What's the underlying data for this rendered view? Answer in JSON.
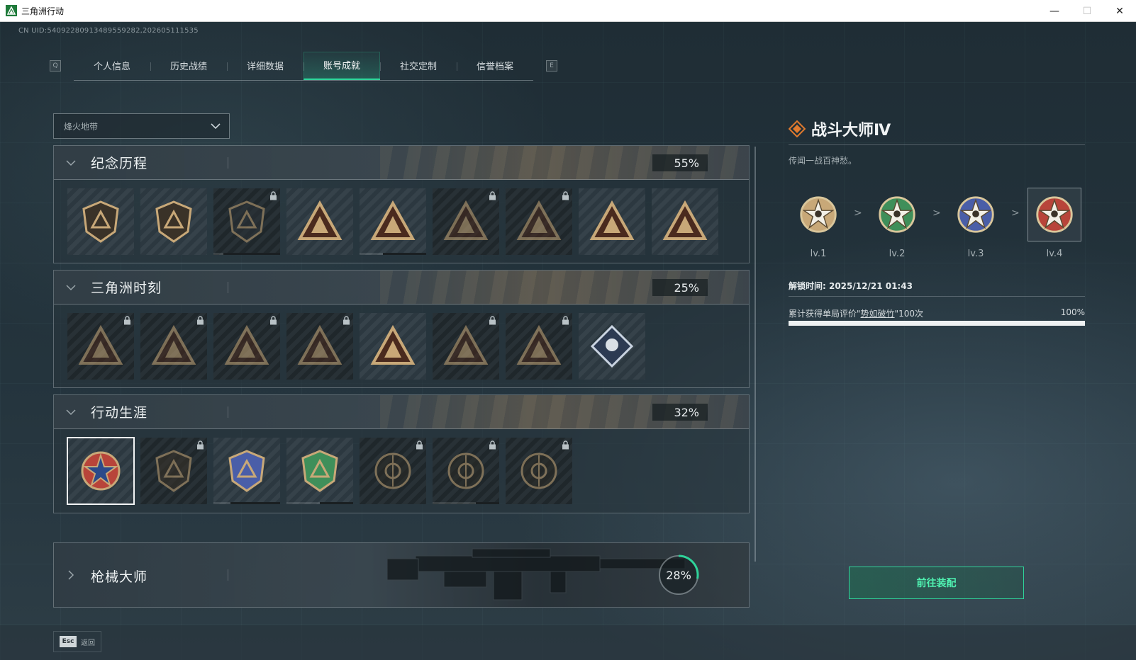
{
  "window": {
    "title": "三角洲行动",
    "minimize": "—",
    "maximize": "☐",
    "close": "✕"
  },
  "uid": "CN UID:540922809134895592​82,202605111535",
  "tabs": {
    "left_key": "Q",
    "right_key": "E",
    "items": [
      {
        "label": "个人信息"
      },
      {
        "label": "历史战绩"
      },
      {
        "label": "详细数据"
      },
      {
        "label": "账号成就",
        "active": true
      },
      {
        "label": "社交定制"
      },
      {
        "label": "信誉档案"
      }
    ]
  },
  "mode_dropdown": {
    "value": "烽火地带"
  },
  "sections": [
    {
      "title": "纪念历程",
      "percent": "55%",
      "badges": [
        {
          "icon": "delta-shield-emblem",
          "locked": false
        },
        {
          "icon": "helicopter-emblem",
          "locked": false
        },
        {
          "icon": "dark-shield-emblem",
          "locked": true,
          "progress": 0.85
        },
        {
          "icon": "doc-triangle-emblem",
          "locked": false
        },
        {
          "icon": "crest-55-emblem",
          "locked": false,
          "progress": 0.65
        },
        {
          "icon": "hooded-figure-emblem",
          "locked": true
        },
        {
          "icon": "skull-guns-emblem",
          "locked": true
        },
        {
          "icon": "hand-triangle-emblem",
          "locked": false
        },
        {
          "icon": "number-one-emblem",
          "locked": false
        }
      ]
    },
    {
      "title": "三角洲时刻",
      "percent": "25%",
      "badges": [
        {
          "icon": "box-triangle-emblem",
          "locked": true
        },
        {
          "icon": "robot-triangle-emblem",
          "locked": true
        },
        {
          "icon": "soldier-triangle-emblem",
          "locked": true
        },
        {
          "icon": "wreath-triangle-emblem",
          "locked": true
        },
        {
          "icon": "squad-triangle-emblem",
          "locked": false
        },
        {
          "icon": "tiger-triangle-emblem",
          "locked": true
        },
        {
          "icon": "fish-triangle-emblem",
          "locked": true
        },
        {
          "icon": "rose-diamond-emblem",
          "locked": false
        }
      ]
    },
    {
      "title": "行动生涯",
      "percent": "32%",
      "badges": [
        {
          "icon": "combat-master-star-emblem",
          "locked": false,
          "selected": true
        },
        {
          "icon": "chevron-shield-emblem",
          "locked": true
        },
        {
          "icon": "blue-shield-emblem",
          "locked": false,
          "progress": 0.75
        },
        {
          "icon": "green-shield-emblem",
          "locked": false,
          "progress": 0.5
        },
        {
          "icon": "circle-ring-emblem",
          "locked": true
        },
        {
          "icon": "crosshair-emblem",
          "locked": true,
          "progress": 0.35
        },
        {
          "icon": "eye-emblem",
          "locked": true
        }
      ]
    }
  ],
  "gun_section": {
    "title": "枪械大师",
    "percent": "28%",
    "progress": 0.28
  },
  "detail": {
    "title": "战斗大师Ⅳ",
    "description": "传闻一战百神愁。",
    "levels": [
      {
        "label": "lv.1",
        "color": "#c8a878"
      },
      {
        "label": "lv.2",
        "color": "#3f8f5a"
      },
      {
        "label": "lv.3",
        "color": "#4a5ea8"
      },
      {
        "label": "lv.4",
        "color": "#b8443a",
        "current": true
      }
    ],
    "level_separator": ">",
    "unlock_time": "解锁时间: 2025/12/21 01:43",
    "condition_prefix": "累计获得单局评价\"",
    "condition_link": "势如破竹",
    "condition_suffix": "\"100次",
    "condition_percent": "100%",
    "condition_progress": 1.0,
    "equip_button": "前往装配"
  },
  "footer": {
    "esc_key": "Esc",
    "esc_label": "返回"
  },
  "colors": {
    "accent": "#2fd39a",
    "gold": "#c8a878"
  }
}
